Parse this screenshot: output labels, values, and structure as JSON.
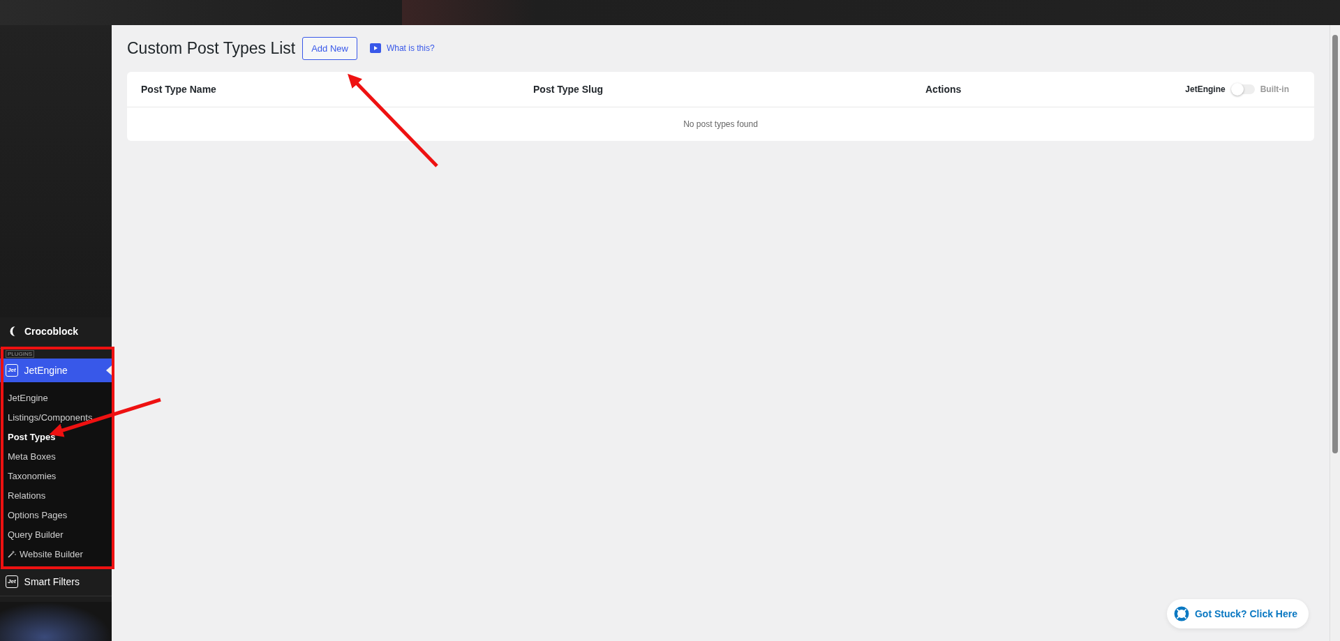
{
  "sidebar": {
    "brand": {
      "label": "Crocoblock"
    },
    "section_label": "PLUGINS",
    "menu": {
      "label": "JetEngine",
      "icon_text": "Jet",
      "expanded": true,
      "items": [
        {
          "label": "JetEngine",
          "selected": false,
          "kind": "link"
        },
        {
          "label": "Listings/Components",
          "selected": false,
          "kind": "link"
        },
        {
          "label": "Post Types",
          "selected": true,
          "kind": "link"
        },
        {
          "label": "Meta Boxes",
          "selected": false,
          "kind": "link"
        },
        {
          "label": "Taxonomies",
          "selected": false,
          "kind": "link"
        },
        {
          "label": "Relations",
          "selected": false,
          "kind": "link"
        },
        {
          "label": "Options Pages",
          "selected": false,
          "kind": "link"
        },
        {
          "label": "Query Builder",
          "selected": false,
          "kind": "link"
        },
        {
          "label": "Website Builder",
          "selected": false,
          "kind": "wand"
        }
      ]
    },
    "next_menu": {
      "label": "Smart Filters",
      "icon_text": "Jet"
    }
  },
  "page": {
    "title": "Custom Post Types List",
    "add_button": "Add New",
    "help_link": "What is this?"
  },
  "table": {
    "columns": [
      "Post Type Name",
      "Post Type Slug",
      "Actions"
    ],
    "source_toggle": {
      "left_label": "JetEngine",
      "right_label": "Built-in",
      "on": false
    },
    "empty_message": "No post types found"
  },
  "help_button": {
    "label": "Got Stuck? Click Here"
  }
}
